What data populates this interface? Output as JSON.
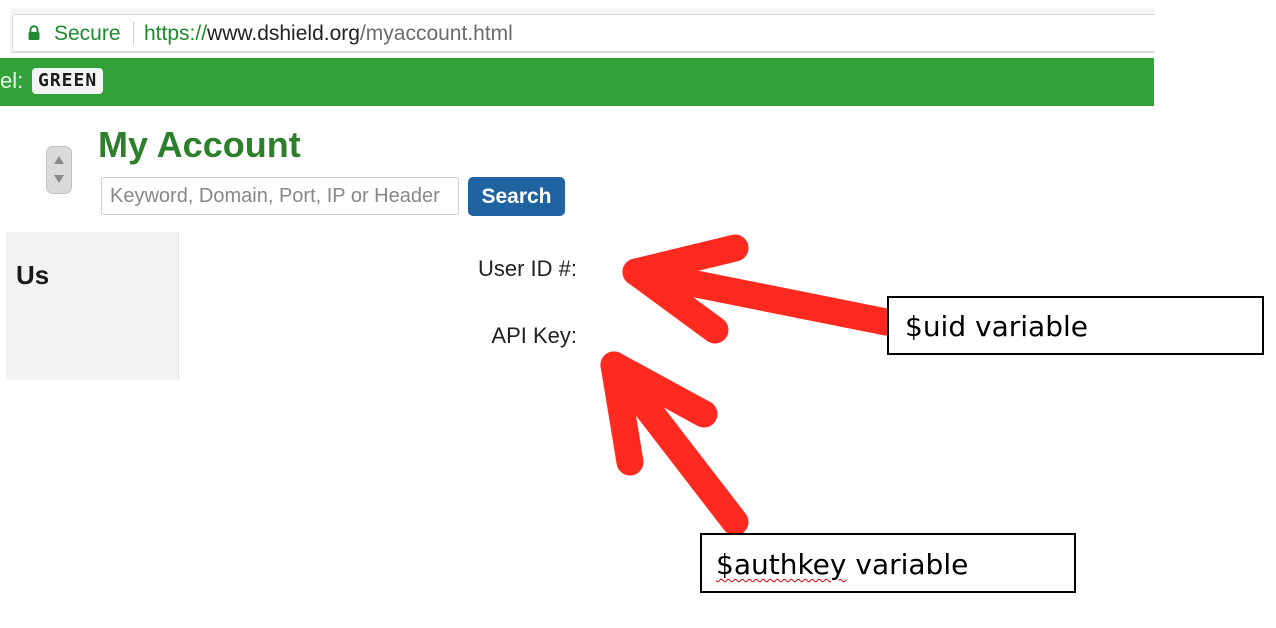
{
  "browser": {
    "secure_label": "Secure",
    "url_scheme": "https://",
    "url_host": "www.dshield.org",
    "url_path": "/myaccount.html",
    "icons": {
      "lock": "lock-icon"
    }
  },
  "threat_banner": {
    "prefix": "el:",
    "level": "GREEN",
    "color": "#33a139"
  },
  "page": {
    "title": "My Account",
    "search": {
      "placeholder": "Keyword, Domain, Port, IP or Header",
      "value": "",
      "button_label": "Search"
    },
    "sidebar_heading": "Us",
    "fields": {
      "user_id_label": "User ID #:",
      "api_key_label": "API Key:"
    },
    "accent_color": "#2d7f2b",
    "button_color": "#1f63a0"
  },
  "annotations": {
    "uid_callout": {
      "variable": "$uid",
      "suffix": " variable"
    },
    "authkey_callout": {
      "variable": "$authkey",
      "suffix": " variable"
    },
    "arrow_color": "#ff2a1f"
  }
}
